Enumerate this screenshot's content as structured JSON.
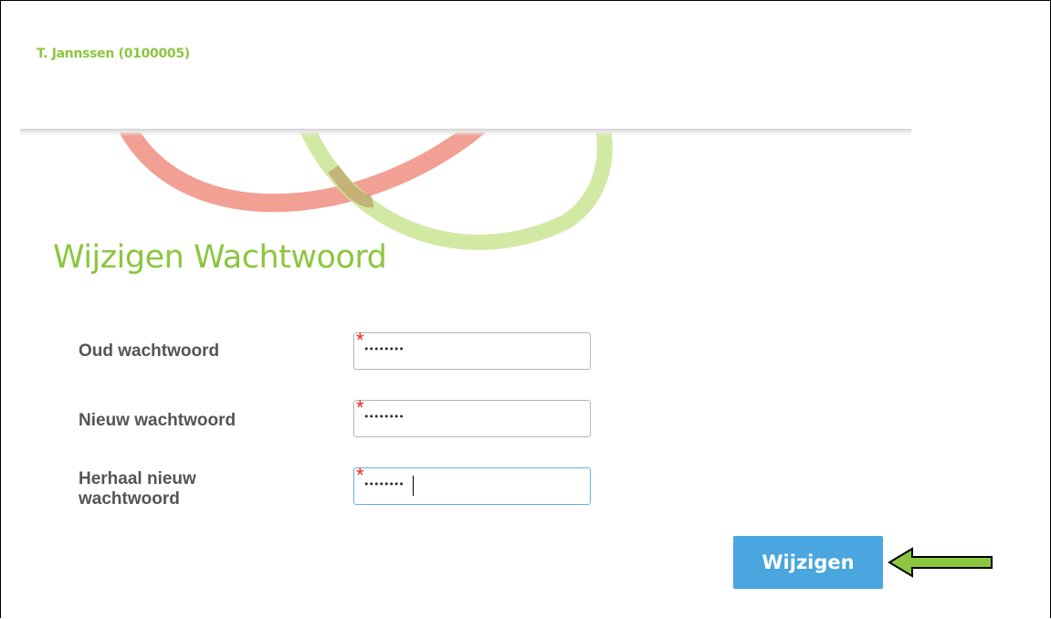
{
  "header": {
    "user_name": "T. Jannssen (0100005)"
  },
  "page": {
    "title": "Wijzigen Wachtwoord"
  },
  "form": {
    "fields": [
      {
        "label": "Oud wachtwoord",
        "required_mark": "*",
        "value": "••••••••"
      },
      {
        "label": "Nieuw wachtwoord",
        "required_mark": "*",
        "value": "••••••••"
      },
      {
        "label": "Herhaal nieuw wachtwoord",
        "required_mark": "*",
        "value": "••••••••"
      }
    ],
    "submit_label": "Wijzigen"
  },
  "colors": {
    "brand_green": "#8cc63f",
    "decor_red": "#f19a8e",
    "decor_green": "#cde79a",
    "button_blue": "#49a6df",
    "required_red": "#ff1a1a",
    "arrow_green": "#8cc63f"
  },
  "icons": {
    "pointer": "arrow-left-icon"
  }
}
